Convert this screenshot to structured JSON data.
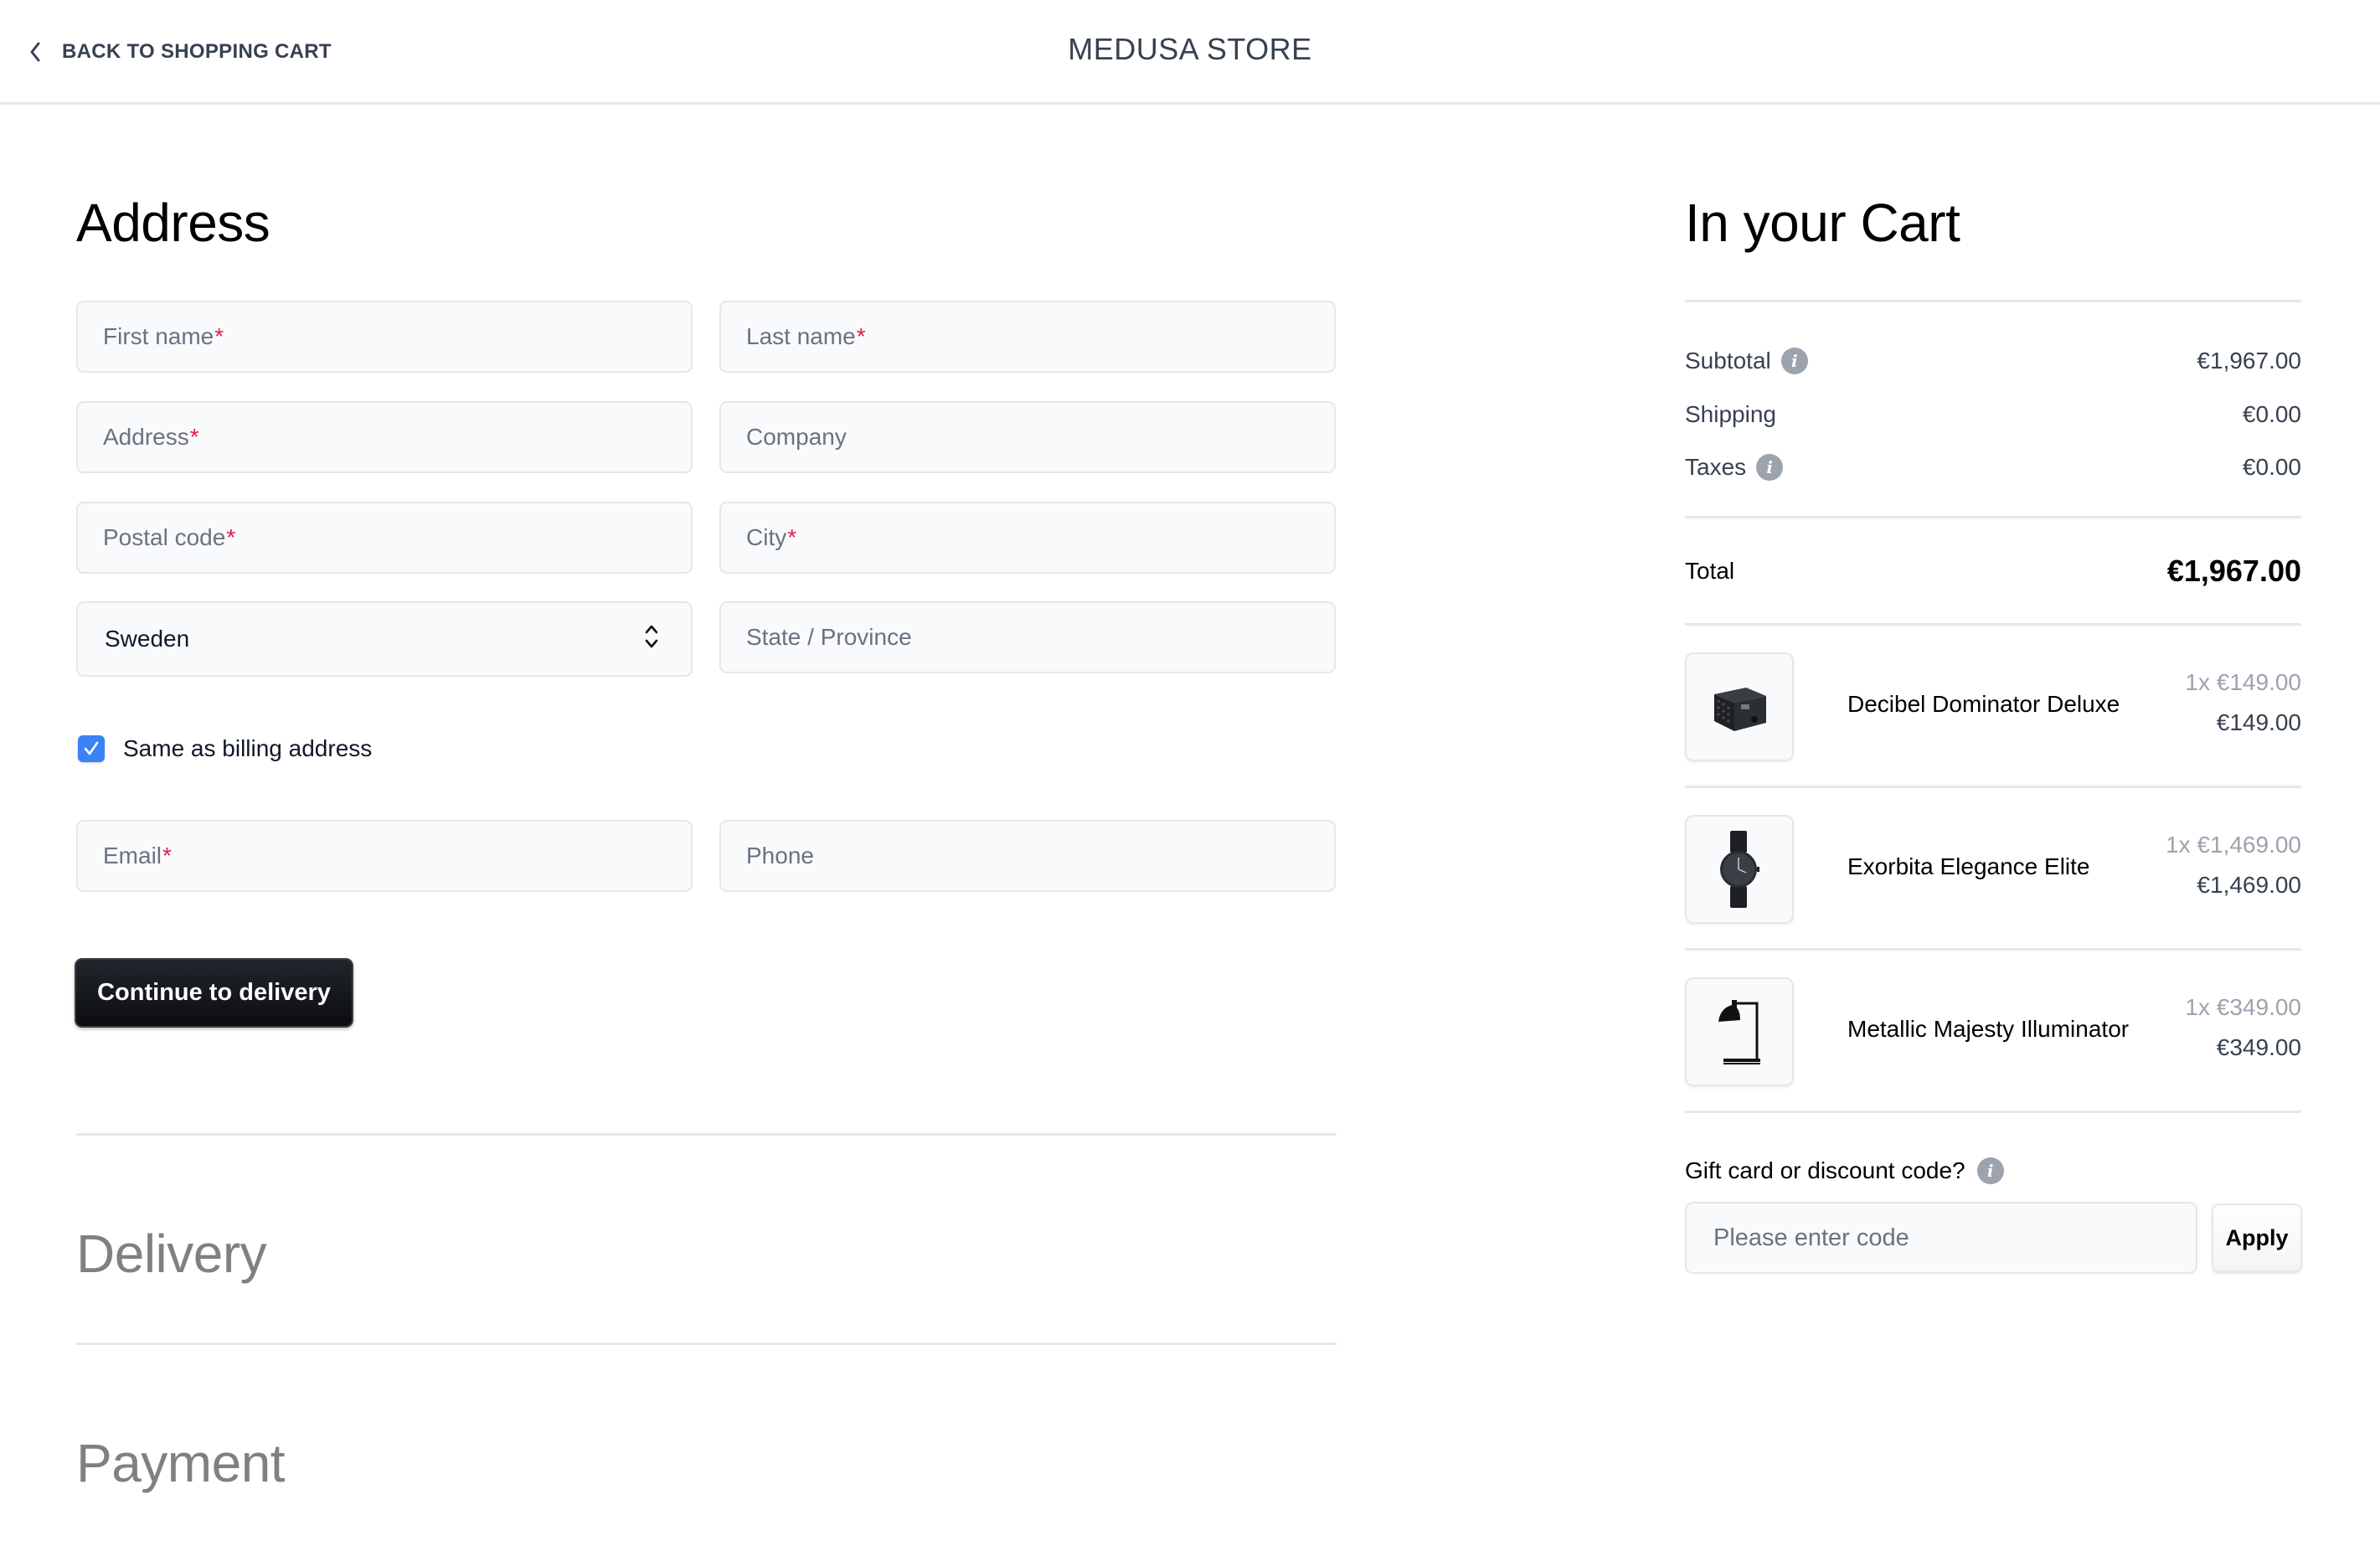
{
  "header": {
    "back_label": "BACK TO SHOPPING CART",
    "store_title": "MEDUSA STORE"
  },
  "address": {
    "heading": "Address",
    "fields": {
      "first_name": {
        "placeholder": "First name",
        "required": "*"
      },
      "last_name": {
        "placeholder": "Last name",
        "required": "*"
      },
      "address": {
        "placeholder": "Address",
        "required": "*"
      },
      "company": {
        "placeholder": "Company"
      },
      "postal_code": {
        "placeholder": "Postal code",
        "required": "*"
      },
      "city": {
        "placeholder": "City",
        "required": "*"
      },
      "country": {
        "value": "Sweden"
      },
      "state": {
        "placeholder": "State / Province"
      },
      "email": {
        "placeholder": "Email",
        "required": "*"
      },
      "phone": {
        "placeholder": "Phone"
      }
    },
    "same_as_billing": {
      "label": "Same as billing address",
      "checked": true
    },
    "continue_label": "Continue to delivery"
  },
  "steps": {
    "delivery": "Delivery",
    "payment": "Payment"
  },
  "cart": {
    "heading": "In your Cart",
    "summary": {
      "subtotal_label": "Subtotal",
      "subtotal_value": "€1,967.00",
      "shipping_label": "Shipping",
      "shipping_value": "€0.00",
      "taxes_label": "Taxes",
      "taxes_value": "€0.00",
      "total_label": "Total",
      "total_value": "€1,967.00"
    },
    "items": [
      {
        "name": "Decibel Dominator Deluxe",
        "unit": "1x €149.00",
        "total": "€149.00",
        "icon": "speaker"
      },
      {
        "name": "Exorbita Elegance Elite",
        "unit": "1x €1,469.00",
        "total": "€1,469.00",
        "icon": "watch"
      },
      {
        "name": "Metallic Majesty Illuminator",
        "unit": "1x €349.00",
        "total": "€349.00",
        "icon": "lamp"
      }
    ],
    "discount": {
      "label": "Gift card or discount code?",
      "placeholder": "Please enter code",
      "apply_label": "Apply"
    }
  },
  "colors": {
    "accent": "#3b82f6",
    "required": "#e11d48",
    "primary_button": "#111318"
  }
}
